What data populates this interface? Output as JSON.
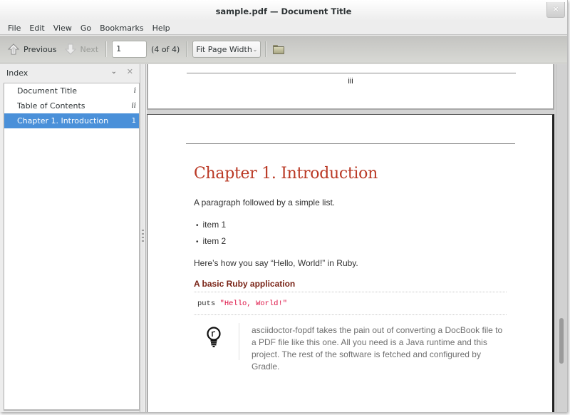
{
  "window": {
    "title": "sample.pdf — Document Title",
    "close_label": "×"
  },
  "menubar": {
    "items": [
      "File",
      "Edit",
      "View",
      "Go",
      "Bookmarks",
      "Help"
    ]
  },
  "toolbar": {
    "previous_label": "Previous",
    "next_label": "Next",
    "page_input_value": "1",
    "page_count": "(4 of 4)",
    "zoom_value": "Fit Page Width",
    "chevron": "⌄",
    "open_icon": "folder-icon"
  },
  "sidebar": {
    "title": "Index",
    "collapse_glyph": "⌄",
    "close_glyph": "✕",
    "items": [
      {
        "label": "Document Title",
        "page": "i",
        "selected": false
      },
      {
        "label": "Table of Contents",
        "page": "ii",
        "selected": false
      },
      {
        "label": "Chapter 1. Introduction",
        "page": "1",
        "selected": true
      }
    ]
  },
  "document": {
    "prev_page_number": "iii",
    "chapter_title": "Chapter 1. Introduction",
    "intro_paragraph": "A paragraph followed by a simple list.",
    "list_items": [
      "item 1",
      "item 2"
    ],
    "bullet": "•",
    "ruby_paragraph": "Here’s how you say “Hello, World!” in Ruby.",
    "listing_title": "A basic Ruby application",
    "code_keyword": "puts",
    "code_string": "\"Hello, World!\"",
    "tip_text": "asciidoctor-fopdf takes the pain out of converting a DocBook file to a PDF file like this one. All you need is a Java runtime and this project. The rest of the software is fetched and configured by Gradle.",
    "tip_icon": "lightbulb-icon",
    "colors": {
      "chapter_title": "#ba3925",
      "listing_title": "#7a2518",
      "code_string": "#dd1144",
      "selection": "#4a90d9"
    }
  },
  "scrollbar": {
    "position_fraction": 0.78
  }
}
